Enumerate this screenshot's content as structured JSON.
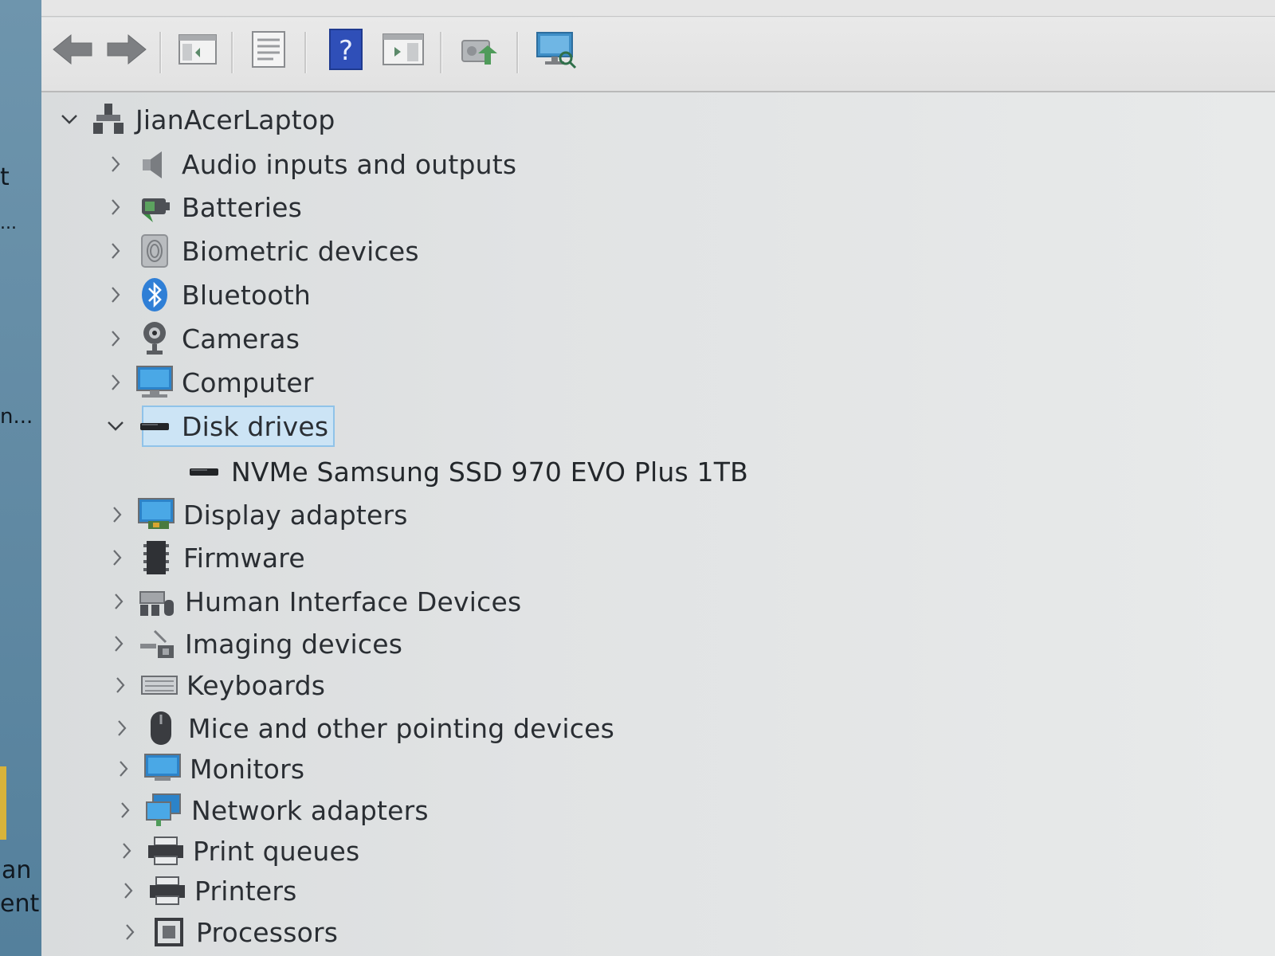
{
  "desktop": {
    "fragments": [
      "t",
      "...",
      "n...",
      "an",
      "ent"
    ],
    "accent_color": "#d8b33a"
  },
  "toolbar": {
    "buttons": [
      {
        "name": "back-button",
        "icon": "arrow-left-icon"
      },
      {
        "name": "forward-button",
        "icon": "arrow-right-icon"
      },
      {
        "name": "show-hide-console-tree-button",
        "icon": "console-tree-icon"
      },
      {
        "name": "properties-button",
        "icon": "properties-icon"
      },
      {
        "name": "help-button",
        "icon": "help-icon",
        "glyph": "?"
      },
      {
        "name": "show-action-pane-button",
        "icon": "action-pane-icon"
      },
      {
        "name": "update-driver-button",
        "icon": "update-driver-icon"
      },
      {
        "name": "scan-hardware-button",
        "icon": "scan-hardware-icon"
      }
    ]
  },
  "tree": {
    "root": {
      "label": "JianAcerLaptop",
      "expanded": true,
      "icon": "computer-root-icon"
    },
    "categories": [
      {
        "label": "Audio inputs and outputs",
        "icon": "speaker-icon",
        "expanded": false
      },
      {
        "label": "Batteries",
        "icon": "battery-icon",
        "expanded": false
      },
      {
        "label": "Biometric devices",
        "icon": "fingerprint-icon",
        "expanded": false
      },
      {
        "label": "Bluetooth",
        "icon": "bluetooth-icon",
        "expanded": false
      },
      {
        "label": "Cameras",
        "icon": "webcam-icon",
        "expanded": false
      },
      {
        "label": "Computer",
        "icon": "monitor-icon",
        "expanded": false
      },
      {
        "label": "Disk drives",
        "icon": "disk-drive-icon",
        "expanded": true,
        "selected": true,
        "children": [
          {
            "label": "NVMe Samsung SSD 970 EVO Plus 1TB",
            "icon": "disk-drive-icon"
          }
        ]
      },
      {
        "label": "Display adapters",
        "icon": "display-adapter-icon",
        "expanded": false
      },
      {
        "label": "Firmware",
        "icon": "firmware-icon",
        "expanded": false
      },
      {
        "label": "Human Interface Devices",
        "icon": "hid-icon",
        "expanded": false
      },
      {
        "label": "Imaging devices",
        "icon": "scanner-icon",
        "expanded": false
      },
      {
        "label": "Keyboards",
        "icon": "keyboard-icon",
        "expanded": false
      },
      {
        "label": "Mice and other pointing devices",
        "icon": "mouse-icon",
        "expanded": false
      },
      {
        "label": "Monitors",
        "icon": "monitor-icon",
        "expanded": false
      },
      {
        "label": "Network adapters",
        "icon": "network-adapter-icon",
        "expanded": false
      },
      {
        "label": "Print queues",
        "icon": "printer-icon",
        "expanded": false
      },
      {
        "label": "Printers",
        "icon": "printer-icon",
        "expanded": false
      },
      {
        "label": "Processors",
        "icon": "processor-icon",
        "expanded": false
      }
    ]
  },
  "colors": {
    "selection_fill": "#cce4f5",
    "selection_border": "#90c3e9",
    "text": "#2a2e33",
    "window_bg": "#e1e3e4"
  }
}
